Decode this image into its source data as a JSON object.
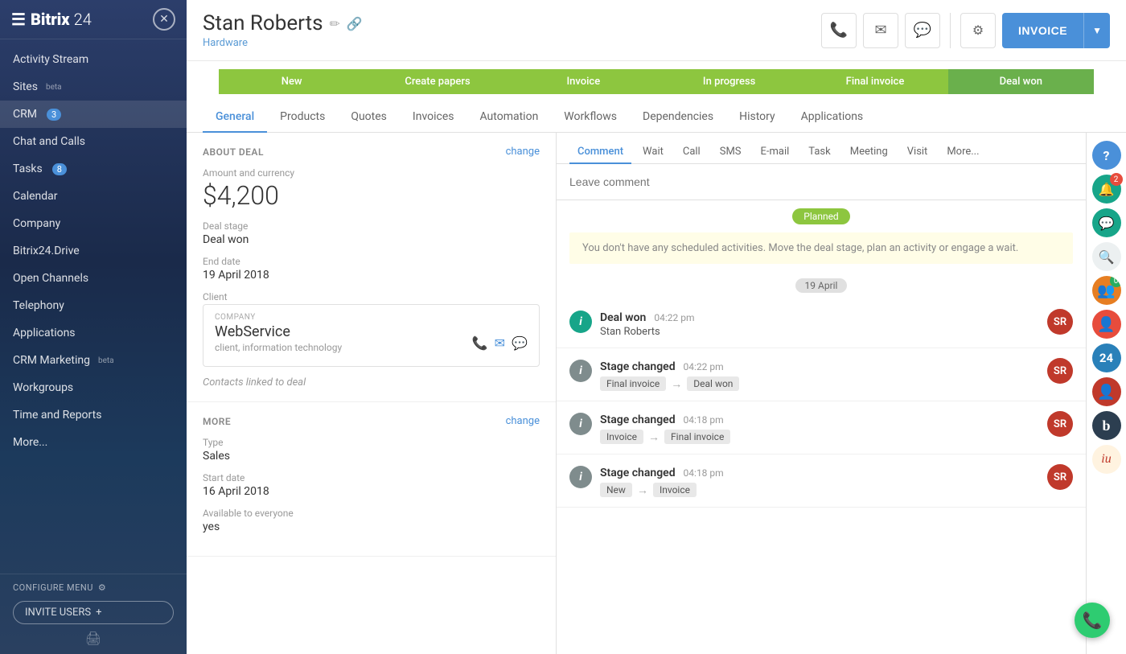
{
  "sidebar": {
    "logo": "Bitrix 24",
    "logo_icon": "☰",
    "close_icon": "✕",
    "nav_items": [
      {
        "id": "activity-stream",
        "label": "Activity Stream",
        "badge": null,
        "beta": false
      },
      {
        "id": "sites",
        "label": "Sites",
        "badge": null,
        "beta": true
      },
      {
        "id": "crm",
        "label": "CRM",
        "badge": "3",
        "badge_type": "blue",
        "beta": false,
        "active": true
      },
      {
        "id": "chat-calls",
        "label": "Chat and Calls",
        "badge": null,
        "beta": false
      },
      {
        "id": "tasks",
        "label": "Tasks",
        "badge": "8",
        "badge_type": "blue",
        "beta": false
      },
      {
        "id": "calendar",
        "label": "Calendar",
        "badge": null,
        "beta": false
      },
      {
        "id": "company",
        "label": "Company",
        "badge": null,
        "beta": false
      },
      {
        "id": "bitrix-drive",
        "label": "Bitrix24.Drive",
        "badge": null,
        "beta": false
      },
      {
        "id": "open-channels",
        "label": "Open Channels",
        "badge": null,
        "beta": false
      },
      {
        "id": "telephony",
        "label": "Telephony",
        "badge": null,
        "beta": false
      },
      {
        "id": "applications",
        "label": "Applications",
        "badge": null,
        "beta": false
      },
      {
        "id": "crm-marketing",
        "label": "CRM Marketing",
        "badge": null,
        "beta": true
      },
      {
        "id": "workgroups",
        "label": "Workgroups",
        "badge": null,
        "beta": false
      },
      {
        "id": "time-reports",
        "label": "Time and Reports",
        "badge": null,
        "beta": false
      },
      {
        "id": "more",
        "label": "More...",
        "badge": null,
        "beta": false
      }
    ],
    "configure_menu": "CONFIGURE MENU",
    "invite_users": "INVITE USERS",
    "invite_icon": "+"
  },
  "deal": {
    "title": "Stan Roberts",
    "subtitle": "Hardware",
    "edit_icon": "✏",
    "link_icon": "🔗"
  },
  "header_actions": {
    "phone_icon": "📞",
    "email_icon": "✉",
    "chat_icon": "💬",
    "settings_icon": "⚙",
    "invoice_label": "INVOICE",
    "invoice_dropdown": "▼"
  },
  "stages": [
    {
      "id": "new",
      "label": "New",
      "active": false
    },
    {
      "id": "create-papers",
      "label": "Create papers",
      "active": false
    },
    {
      "id": "invoice",
      "label": "Invoice",
      "active": false
    },
    {
      "id": "in-progress",
      "label": "In progress",
      "active": false
    },
    {
      "id": "final-invoice",
      "label": "Final invoice",
      "active": false
    },
    {
      "id": "deal-won",
      "label": "Deal won",
      "active": true
    }
  ],
  "tabs": [
    {
      "id": "general",
      "label": "General",
      "active": true
    },
    {
      "id": "products",
      "label": "Products",
      "active": false
    },
    {
      "id": "quotes",
      "label": "Quotes",
      "active": false
    },
    {
      "id": "invoices",
      "label": "Invoices",
      "active": false
    },
    {
      "id": "automation",
      "label": "Automation",
      "active": false
    },
    {
      "id": "workflows",
      "label": "Workflows",
      "active": false
    },
    {
      "id": "dependencies",
      "label": "Dependencies",
      "active": false
    },
    {
      "id": "history",
      "label": "History",
      "active": false
    },
    {
      "id": "applications",
      "label": "Applications",
      "active": false
    }
  ],
  "about_deal": {
    "section_title": "ABOUT DEAL",
    "change_label": "change",
    "amount_label": "Amount and currency",
    "amount_currency": "$",
    "amount_value": "4,200",
    "deal_stage_label": "Deal stage",
    "deal_stage_value": "Deal won",
    "end_date_label": "End date",
    "end_date_value": "19 April 2018",
    "client_label": "Client",
    "company_label": "COMPANY",
    "company_name": "WebService",
    "company_tags": "client, information technology",
    "contacts_linked": "Contacts linked to deal"
  },
  "more_section": {
    "section_title": "MORE",
    "change_label": "change",
    "type_label": "Type",
    "type_value": "Sales",
    "start_date_label": "Start date",
    "start_date_value": "16 April 2018",
    "available_label": "Available to everyone",
    "available_value": "yes"
  },
  "activity": {
    "tabs": [
      {
        "id": "comment",
        "label": "Comment",
        "active": true
      },
      {
        "id": "wait",
        "label": "Wait",
        "active": false
      },
      {
        "id": "call",
        "label": "Call",
        "active": false
      },
      {
        "id": "sms",
        "label": "SMS",
        "active": false
      },
      {
        "id": "email",
        "label": "E-mail",
        "active": false
      },
      {
        "id": "task",
        "label": "Task",
        "active": false
      },
      {
        "id": "meeting",
        "label": "Meeting",
        "active": false
      },
      {
        "id": "visit",
        "label": "Visit",
        "active": false
      },
      {
        "id": "more",
        "label": "More...",
        "active": false
      }
    ],
    "comment_placeholder": "Leave comment",
    "planned_badge": "Planned",
    "no_activity_text": "You don't have any scheduled activities. Move the deal stage, plan an activity or engage a wait.",
    "date_divider": "19 April",
    "items": [
      {
        "id": "deal-won-1",
        "icon_type": "teal",
        "icon": "i",
        "title": "Deal won",
        "time": "04:22 pm",
        "subtitle": "Stan Roberts",
        "has_avatar": true,
        "avatar_initials": "SR"
      },
      {
        "id": "stage-changed-1",
        "icon_type": "blue-gray",
        "icon": "i",
        "title": "Stage changed",
        "time": "04:22 pm",
        "from_stage": "Final invoice",
        "to_stage": "Deal won",
        "has_avatar": true,
        "avatar_initials": "SR"
      },
      {
        "id": "stage-changed-2",
        "icon_type": "blue-gray",
        "icon": "i",
        "title": "Stage changed",
        "time": "04:18 pm",
        "from_stage": "Invoice",
        "to_stage": "Final invoice",
        "has_avatar": true,
        "avatar_initials": "SR"
      },
      {
        "id": "stage-changed-3",
        "icon_type": "blue-gray",
        "icon": "i",
        "title": "Stage changed",
        "time": "04:18 pm",
        "from_stage": "New",
        "to_stage": "Invoice",
        "has_avatar": true,
        "avatar_initials": "SR"
      }
    ]
  },
  "right_rail": {
    "items": [
      {
        "id": "help",
        "type": "icon",
        "icon": "?",
        "bg": "blue-bg"
      },
      {
        "id": "notifications",
        "type": "icon",
        "icon": "🔔",
        "bg": "teal-bg",
        "badge": "2"
      },
      {
        "id": "chat",
        "type": "icon",
        "icon": "💬",
        "bg": "teal-bg"
      },
      {
        "id": "search",
        "type": "icon",
        "icon": "🔍",
        "bg": "light-bg"
      },
      {
        "id": "group1",
        "type": "avatar-group",
        "bg": "orange-bg"
      },
      {
        "id": "avatar2",
        "type": "avatar",
        "color": "#e74c3c",
        "initials": ""
      },
      {
        "id": "bitrix24-icon",
        "type": "number",
        "label": "24",
        "bg": "#2980b9"
      },
      {
        "id": "person3",
        "type": "avatar",
        "color": "#c0392b",
        "initials": ""
      },
      {
        "id": "b-logo",
        "type": "b",
        "label": "b",
        "bg": "dark-bg"
      },
      {
        "id": "iu-logo",
        "type": "iu",
        "label": "iu"
      }
    ]
  },
  "phone_float": "📞"
}
